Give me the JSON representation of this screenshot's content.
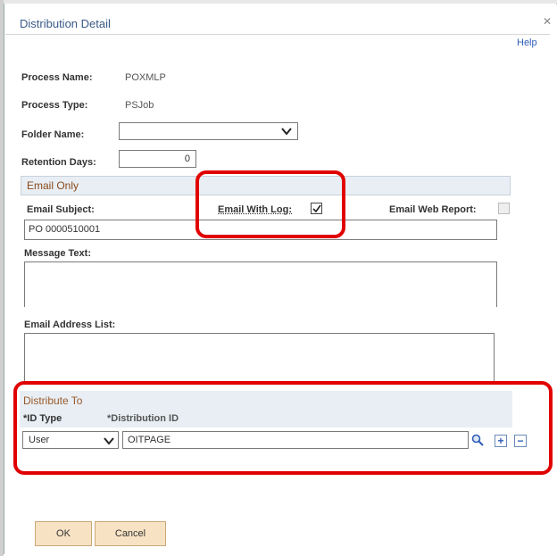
{
  "dialog": {
    "title": "Distribution Detail",
    "close": "✕",
    "help": "Help"
  },
  "process": {
    "name_label": "Process Name:",
    "name_value": "POXMLP",
    "type_label": "Process Type:",
    "type_value": "PSJob",
    "folder_label": "Folder Name:",
    "folder_value": "",
    "retention_label": "Retention Days:",
    "retention_value": "0"
  },
  "email": {
    "section_title": "Email Only",
    "subject_label": "Email Subject:",
    "subject_value": "PO 0000510001",
    "with_log_label": "Email With Log:",
    "with_log_checked": true,
    "web_report_label": "Email Web Report:",
    "web_report_checked": false,
    "message_label": "Message Text:",
    "message_value": "",
    "address_label": "Email Address List:",
    "address_value": ""
  },
  "distribute": {
    "section_title": "Distribute To",
    "col_id_type": "*ID Type",
    "col_dist_id": "*Distribution ID",
    "row": {
      "id_type": "User",
      "dist_id": "OITPAGE"
    }
  },
  "buttons": {
    "ok": "OK",
    "cancel": "Cancel"
  },
  "icons": {
    "close": "close-icon",
    "dropdown": "chevron-down-icon",
    "lookup": "magnifier-icon",
    "add": "plus-icon",
    "remove": "minus-icon",
    "check": "checkmark-icon"
  },
  "colors": {
    "highlight": "#e00000",
    "section_bg": "#e8eef4",
    "section_heading": "#8a4a1a",
    "button_bg": "#f7e2c4",
    "link": "#2e5cb8"
  }
}
